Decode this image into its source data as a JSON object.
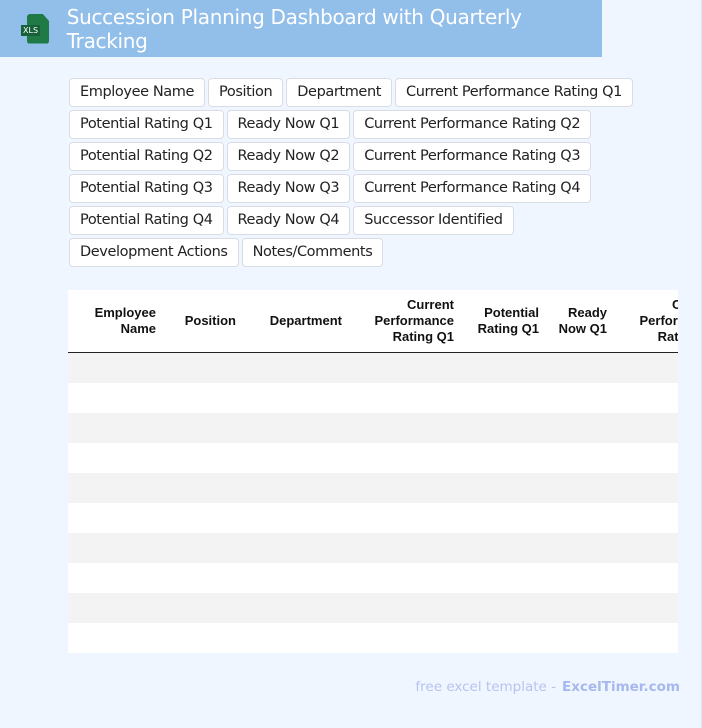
{
  "header": {
    "title": "Succession Planning Dashboard with Quarterly Tracking",
    "logo_text": "XLS",
    "logo_icon": "excel-file-icon"
  },
  "columns": [
    "Employee Name",
    "Position",
    "Department",
    "Current Performance Rating Q1",
    "Potential Rating Q1",
    "Ready Now Q1",
    "Current Performance Rating Q2",
    "Potential Rating Q2",
    "Ready Now Q2",
    "Current Performance Rating Q3",
    "Potential Rating Q3",
    "Ready Now Q3",
    "Current Performance Rating Q4",
    "Potential Rating Q4",
    "Ready Now Q4",
    "Successor Identified",
    "Development Actions",
    "Notes/Comments"
  ],
  "table": {
    "header_labels": [
      "Employee Name",
      "Position",
      "Department",
      "Current Performance Rating Q1",
      "Potential Rating Q1",
      "Ready Now Q1",
      "Current Performance Rating Q2",
      "Potential Rating Q2",
      "Ready Now Q2",
      "Current Performance Rating Q3",
      "Potential Rating Q3",
      "Ready Now Q3",
      "Current Performance Rating Q4",
      "Potential Rating Q4",
      "Ready Now Q4",
      "Successor Identified",
      "Development Actions",
      "Notes/Comments"
    ],
    "row_count": 10
  },
  "footer": {
    "text": "free excel template -",
    "brand": "ExcelTimer.com"
  }
}
